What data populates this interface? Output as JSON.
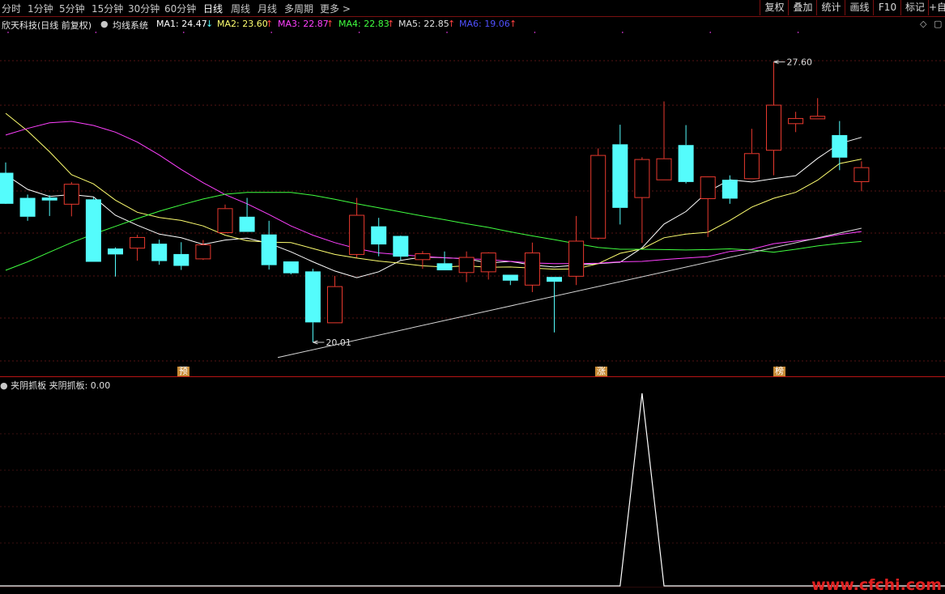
{
  "toolbar": {
    "periods": [
      "分时",
      "1分钟",
      "5分钟",
      "15分钟",
      "30分钟",
      "60分钟",
      "日线",
      "周线",
      "月线",
      "多周期",
      "更多 >"
    ],
    "active_period": "日线",
    "right_buttons": [
      "复权",
      "叠加",
      "统计",
      "画线",
      "F10",
      "标记",
      "+自"
    ]
  },
  "info": {
    "stock_title": "欣天科技(日线 前复权)",
    "indicator": "均线系统",
    "ma1": "MA1: 24.47",
    "ma1_arrow": "↓",
    "ma2": "MA2: 23.60",
    "ma2_arrow": "↑",
    "ma3": "MA3: 22.87",
    "ma3_arrow": "↑",
    "ma4": "MA4: 22.83",
    "ma4_arrow": "↑",
    "ma5": "MA5: 22.85",
    "ma5_arrow": "↑",
    "ma6": "MA6: 19.06",
    "ma6_arrow": "↑"
  },
  "colors": {
    "up": "#e8392e",
    "down": "#54fcfc",
    "ma1": "#ffffff",
    "ma2": "#ffff70",
    "ma3": "#ff40ff",
    "ma4": "#40ff40",
    "ma5": "#ffffff",
    "ma6": "#5050ff",
    "grid": "#551515",
    "bg": "#000000"
  },
  "markers": {
    "max_label": "27.60",
    "min_label": "20.01"
  },
  "event_tags": [
    "预",
    "涨",
    "榜"
  ],
  "volume_panel": {
    "label": "夹阴抓板",
    "value_text": "夹阴抓板: 0.00"
  },
  "watermark": "www.cfchi.com",
  "chart_data": [
    {
      "type": "candlestick",
      "title": "欣天科技(日线 前复权)",
      "ylim": [
        19.2,
        28.4
      ],
      "candles": [
        {
          "o": 24.6,
          "h": 24.88,
          "l": 23.82,
          "c": 23.76
        },
        {
          "o": 23.92,
          "h": 24.01,
          "l": 23.3,
          "c": 23.41
        },
        {
          "o": 23.93,
          "h": 23.99,
          "l": 23.43,
          "c": 23.85
        },
        {
          "o": 23.76,
          "h": 24.35,
          "l": 23.42,
          "c": 24.3
        },
        {
          "o": 23.88,
          "h": 23.93,
          "l": 22.19,
          "c": 22.19
        },
        {
          "o": 22.55,
          "h": 22.58,
          "l": 21.79,
          "c": 22.39
        },
        {
          "o": 22.57,
          "h": 22.92,
          "l": 22.22,
          "c": 22.86
        },
        {
          "o": 22.68,
          "h": 22.79,
          "l": 22.11,
          "c": 22.21
        },
        {
          "o": 22.4,
          "h": 22.72,
          "l": 21.97,
          "c": 22.08
        },
        {
          "o": 22.28,
          "h": 22.78,
          "l": 22.24,
          "c": 22.66
        },
        {
          "o": 22.99,
          "h": 23.74,
          "l": 22.96,
          "c": 23.64
        },
        {
          "o": 23.41,
          "h": 23.92,
          "l": 23.0,
          "c": 23.0
        },
        {
          "o": 22.93,
          "h": 23.3,
          "l": 21.98,
          "c": 22.1
        },
        {
          "o": 22.2,
          "h": 22.2,
          "l": 21.85,
          "c": 21.88
        },
        {
          "o": 21.93,
          "h": 22.0,
          "l": 20.01,
          "c": 20.55
        },
        {
          "o": 20.55,
          "h": 21.81,
          "l": 20.55,
          "c": 21.53
        },
        {
          "o": 22.4,
          "h": 23.92,
          "l": 22.3,
          "c": 23.46
        },
        {
          "o": 23.15,
          "h": 23.38,
          "l": 22.34,
          "c": 22.66
        },
        {
          "o": 22.89,
          "h": 22.9,
          "l": 22.24,
          "c": 22.33
        },
        {
          "o": 22.26,
          "h": 22.48,
          "l": 22.0,
          "c": 22.42
        },
        {
          "o": 22.15,
          "h": 22.47,
          "l": 21.96,
          "c": 21.96
        },
        {
          "o": 21.91,
          "h": 22.47,
          "l": 21.64,
          "c": 22.32
        },
        {
          "o": 21.93,
          "h": 22.45,
          "l": 21.71,
          "c": 22.44
        },
        {
          "o": 21.84,
          "h": 21.84,
          "l": 21.56,
          "c": 21.68
        },
        {
          "o": 21.57,
          "h": 22.71,
          "l": 21.37,
          "c": 22.44
        },
        {
          "o": 21.78,
          "h": 21.78,
          "l": 20.28,
          "c": 21.65
        },
        {
          "o": 21.81,
          "h": 23.43,
          "l": 21.56,
          "c": 22.76
        },
        {
          "o": 22.84,
          "h": 25.26,
          "l": 22.79,
          "c": 25.08
        },
        {
          "o": 25.37,
          "h": 25.9,
          "l": 23.2,
          "c": 23.65
        },
        {
          "o": 23.94,
          "h": 25.02,
          "l": 22.7,
          "c": 24.97
        },
        {
          "o": 24.42,
          "h": 26.53,
          "l": 24.42,
          "c": 24.99
        },
        {
          "o": 25.35,
          "h": 25.89,
          "l": 24.31,
          "c": 24.35
        },
        {
          "o": 23.91,
          "h": 24.48,
          "l": 22.86,
          "c": 24.5
        },
        {
          "o": 24.41,
          "h": 24.53,
          "l": 23.76,
          "c": 23.9
        },
        {
          "o": 24.45,
          "h": 25.79,
          "l": 24.45,
          "c": 25.13
        },
        {
          "o": 25.22,
          "h": 27.6,
          "l": 24.53,
          "c": 26.44
        },
        {
          "o": 25.94,
          "h": 26.25,
          "l": 25.7,
          "c": 26.08
        },
        {
          "o": 26.07,
          "h": 26.62,
          "l": 26.07,
          "c": 26.14
        },
        {
          "o": 25.62,
          "h": 26.0,
          "l": 24.67,
          "c": 25.01
        },
        {
          "o": 24.37,
          "h": 24.91,
          "l": 24.1,
          "c": 24.75
        }
      ],
      "series": [
        {
          "name": "MA1",
          "values": [
            24.55,
            24.15,
            23.96,
            24.01,
            23.95,
            23.45,
            23.18,
            22.94,
            22.84,
            22.66,
            22.78,
            22.83,
            22.69,
            22.46,
            22.19,
            21.94,
            21.76,
            21.92,
            22.23,
            22.32,
            22.3,
            22.27,
            22.16,
            22.2,
            22.1,
            22.05,
            22.1,
            22.14,
            22.18,
            22.57,
            23.21,
            23.55,
            24.09,
            24.41,
            24.35,
            24.44,
            24.52,
            24.99,
            25.39,
            25.56
          ]
        },
        {
          "name": "MA2",
          "values": [
            26.21,
            25.73,
            25.17,
            24.55,
            24.3,
            23.86,
            23.53,
            23.39,
            23.31,
            23.16,
            22.91,
            22.76,
            22.72,
            22.71,
            22.55,
            22.39,
            22.29,
            22.21,
            22.15,
            22.08,
            22.05,
            22.08,
            22.04,
            22.05,
            22.02,
            21.99,
            22.0,
            22.14,
            22.42,
            22.54,
            22.84,
            22.94,
            22.99,
            23.31,
            23.67,
            23.91,
            24.07,
            24.4,
            24.85,
            24.97
          ]
        },
        {
          "name": "MA3",
          "values": [
            25.62,
            25.8,
            25.95,
            25.99,
            25.88,
            25.7,
            25.43,
            25.08,
            24.69,
            24.33,
            24.01,
            23.76,
            23.47,
            23.16,
            22.91,
            22.71,
            22.55,
            22.43,
            22.38,
            22.34,
            22.3,
            22.27,
            22.25,
            22.2,
            22.16,
            22.14,
            22.14,
            22.15,
            22.19,
            22.2,
            22.25,
            22.29,
            22.33,
            22.47,
            22.53,
            22.68,
            22.75,
            22.82,
            22.93,
            23.01
          ]
        },
        {
          "name": "MA4",
          "values": [
            21.96,
            22.19,
            22.45,
            22.71,
            22.94,
            23.15,
            23.36,
            23.56,
            23.73,
            23.89,
            24.02,
            24.07,
            24.07,
            24.07,
            23.99,
            23.88,
            23.76,
            23.65,
            23.54,
            23.43,
            23.33,
            23.22,
            23.12,
            23.0,
            22.89,
            22.79,
            22.68,
            22.58,
            22.53,
            22.53,
            22.52,
            22.51,
            22.52,
            22.54,
            22.51,
            22.45,
            22.53,
            22.62,
            22.69,
            22.74
          ]
        }
      ]
    },
    {
      "type": "line",
      "title": "夹阴抓板",
      "ylim": [
        0,
        1
      ],
      "values": [
        0,
        0,
        0,
        0,
        0,
        0,
        0,
        0,
        0,
        0,
        0,
        0,
        0,
        0,
        0,
        0,
        0,
        0,
        0,
        0,
        0,
        0,
        0,
        0,
        0,
        0,
        0,
        0,
        0,
        1,
        0,
        0,
        0,
        0,
        0,
        0,
        0,
        0,
        0,
        0
      ]
    }
  ]
}
